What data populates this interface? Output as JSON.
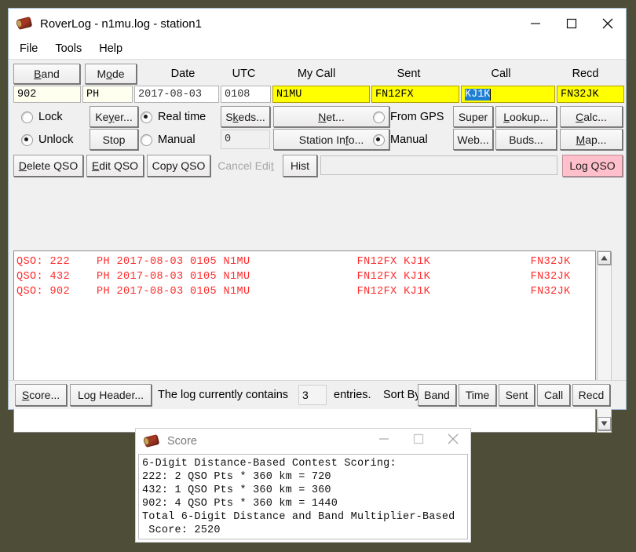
{
  "desktop": {
    "background": "#4e4e38"
  },
  "main_window": {
    "title": "RoverLog - n1mu.log - station1",
    "icon": "roverlog-app-icon",
    "window_controls": {
      "minimize": "─",
      "maximize": "☐",
      "close": "✕"
    },
    "menu": [
      {
        "label": "File"
      },
      {
        "label": "Tools"
      },
      {
        "label": "Help"
      }
    ],
    "columns": [
      {
        "name": "band",
        "label": "Band",
        "accel": "B",
        "is_button": true
      },
      {
        "name": "mode",
        "label": "Mode",
        "accel": "o",
        "is_button": true
      },
      {
        "name": "date",
        "label": "Date",
        "is_button": false
      },
      {
        "name": "utc",
        "label": "UTC",
        "is_button": false
      },
      {
        "name": "my-call",
        "label": "My Call",
        "is_button": false
      },
      {
        "name": "sent",
        "label": "Sent",
        "is_button": false
      },
      {
        "name": "call",
        "label": "Call",
        "is_button": false
      },
      {
        "name": "recd",
        "label": "Recd",
        "is_button": false
      }
    ],
    "entry_fields": {
      "band": "902",
      "mode": "PH",
      "date": "2017-08-03",
      "utc": "0108",
      "my_call": "N1MU",
      "sent": "FN12FX",
      "call": "KJ1K",
      "recd": "FN32JK"
    },
    "lock_group": {
      "lock": "Lock",
      "unlock": "Unlock",
      "selected": "unlock"
    },
    "keyer": {
      "keyer_label": "Keyer...",
      "keyer_accel": "y",
      "stop_label": "Stop"
    },
    "time_group": {
      "real_time": "Real time",
      "manual": "Manual",
      "selected": "real_time"
    },
    "skeds_label": "Skeds...",
    "skeds_accel": "k",
    "offset_value": "0",
    "net_label": "Net...",
    "net_accel": "N",
    "station_info_label": "Station Info...",
    "station_info_accel": "f",
    "gps_group": {
      "from_gps": "From GPS",
      "manual": "Manual",
      "selected": "manual"
    },
    "super_label": "Super",
    "web_label": "Web...",
    "lookup_label": "Lookup...",
    "lookup_accel": "L",
    "buds_label": "Buds...",
    "calc_label": "Calc...",
    "calc_accel": "C",
    "map_label": "Map...",
    "map_accel": "M",
    "qso_toolbar": {
      "delete_qso": "Delete QSO",
      "delete_accel": "D",
      "edit_qso": "Edit QSO",
      "edit_accel": "E",
      "copy_qso": "Copy QSO",
      "cancel_edit": "Cancel Edit",
      "cancel_accel": "t",
      "cancel_enabled": false,
      "hist": "Hist",
      "note_value": "",
      "log_qso": "Log QSO",
      "log_qso_color": "#ffc0cb"
    },
    "qso_rows": [
      {
        "text": "QSO: 222    PH 2017-08-03 0105 N1MU                FN12FX KJ1K               FN32JK"
      },
      {
        "text": "QSO: 432    PH 2017-08-03 0105 N1MU                FN12FX KJ1K               FN32JK"
      },
      {
        "text": "QSO: 902    PH 2017-08-03 0105 N1MU                FN12FX KJ1K               FN32JK"
      }
    ],
    "qso_text_color": "#ff2b2b",
    "statusbar": {
      "score_label": "Score...",
      "score_accel": "S",
      "log_header_label": "Log Header...",
      "contains_text": "The log currently contains",
      "entry_count": "3",
      "entries_text": "entries.",
      "sort_by_text": "Sort By",
      "sort_buttons": [
        {
          "label": "Band"
        },
        {
          "label": "Time"
        },
        {
          "label": "Sent"
        },
        {
          "label": "Call"
        },
        {
          "label": "Recd"
        }
      ]
    }
  },
  "score_window": {
    "title": "Score",
    "icon": "roverlog-app-icon",
    "window_controls": {
      "minimize": "─",
      "maximize": "☐",
      "close": "✕"
    },
    "lines": [
      "6-Digit Distance-Based Contest Scoring:",
      "222: 2 QSO Pts * 360 km = 720",
      "432: 1 QSO Pts * 360 km = 360",
      "902: 4 QSO Pts * 360 km = 1440",
      "Total 6-Digit Distance and Band Multiplier-Based",
      " Score: 2520"
    ]
  }
}
